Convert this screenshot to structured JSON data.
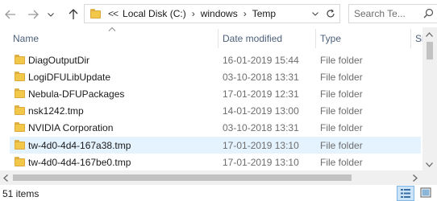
{
  "navigation": {
    "back_icon": "back-arrow-icon",
    "forward_icon": "forward-arrow-icon",
    "recent_icon": "chevron-down-icon",
    "up_icon": "up-arrow-icon"
  },
  "address": {
    "overflow": "<<",
    "segments": [
      "Local Disk (C:)",
      "windows",
      "Temp"
    ]
  },
  "search": {
    "placeholder": "Search Te..."
  },
  "columns": {
    "name": "Name",
    "date": "Date modified",
    "type": "Type",
    "size": "Size"
  },
  "files": [
    {
      "name": "DiagOutputDir",
      "date": "16-01-2019 15:44",
      "type": "File folder",
      "selected": false
    },
    {
      "name": "LogiDFULibUpdate",
      "date": "03-10-2018 13:31",
      "type": "File folder",
      "selected": false
    },
    {
      "name": "Nebula-DFUPackages",
      "date": "17-01-2019 12:31",
      "type": "File folder",
      "selected": false
    },
    {
      "name": "nsk1242.tmp",
      "date": "14-01-2019 13:00",
      "type": "File folder",
      "selected": false
    },
    {
      "name": "NVIDIA Corporation",
      "date": "03-10-2018 13:31",
      "type": "File folder",
      "selected": false
    },
    {
      "name": "tw-4d0-4d4-167a38.tmp",
      "date": "17-01-2019 13:10",
      "type": "File folder",
      "selected": true
    },
    {
      "name": "tw-4d0-4d4-167be0.tmp",
      "date": "17-01-2019 13:10",
      "type": "File folder",
      "selected": false
    }
  ],
  "status": {
    "item_count": "51 items"
  },
  "colors": {
    "selection": "#e5f3ff",
    "header_text": "#4c607a",
    "folder": "#f2c84b"
  }
}
